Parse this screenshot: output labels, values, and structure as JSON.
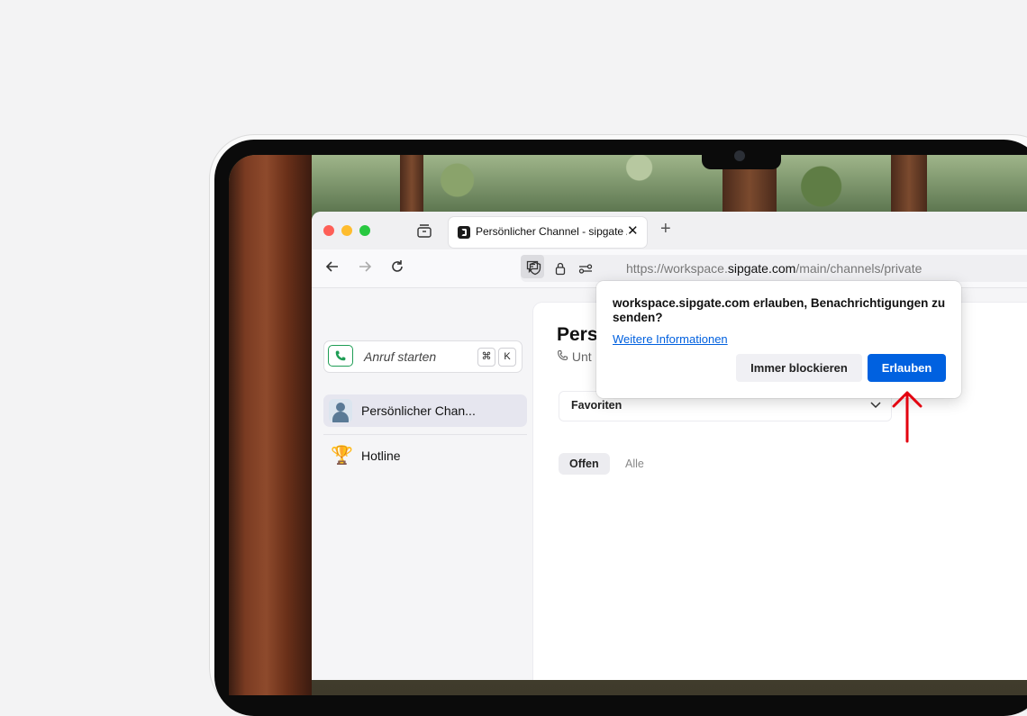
{
  "browser": {
    "tab": {
      "title": "Persönlicher Channel - sipgate / ...",
      "close_label": "✕"
    },
    "new_tab_label": "+",
    "url": {
      "prefix": "https://workspace.",
      "domain": "sipgate.com",
      "path": "/main/channels/private"
    }
  },
  "sidebar": {
    "call_placeholder": "Anruf starten",
    "shortcut": [
      "⌘",
      "K"
    ],
    "items": [
      {
        "label": "Persönlicher Chan...",
        "icon": "person-avatar",
        "active": true
      },
      {
        "label": "Hotline",
        "icon": "trophy-icon",
        "emoji": "🏆",
        "active": false
      }
    ]
  },
  "main": {
    "title": "Pers",
    "subtitle": "Unt",
    "favorites_label": "Favoriten",
    "filters": [
      "Offen",
      "Alle"
    ]
  },
  "popup": {
    "message": "workspace.sipgate.com erlauben, Benachrichtigungen zu senden?",
    "link": "Weitere Informationen",
    "block_label": "Immer blockieren",
    "allow_label": "Erlauben"
  },
  "colors": {
    "allow_button": "#0061e0",
    "arrow": "#e3000f",
    "call_green": "#1f9d55"
  }
}
